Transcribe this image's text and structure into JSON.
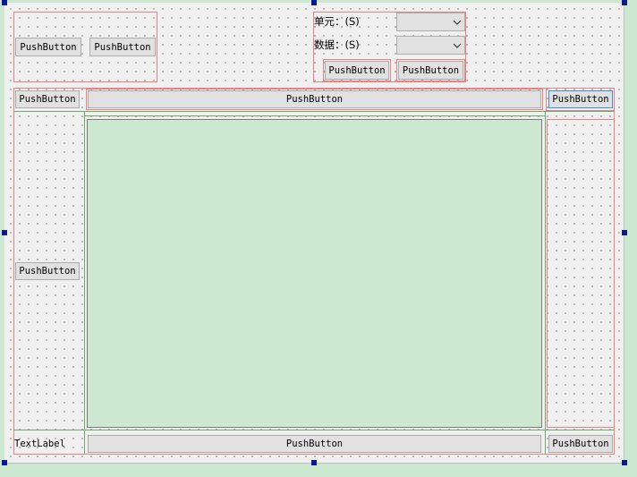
{
  "top_left_group": {
    "button_1": "PushButton",
    "button_2": "PushButton"
  },
  "top_right_group": {
    "unit_label": "单元：(S)",
    "data_label": "数据：(S)",
    "unit_combo_value": "",
    "data_combo_value": "",
    "button_1": "PushButton",
    "button_2": "PushButton"
  },
  "toolbar": {
    "left_button": "PushButton",
    "center_button": "PushButton",
    "right_button": "PushButton"
  },
  "side_panel": {
    "left_button": "PushButton"
  },
  "footer": {
    "text_label": "TextLabel",
    "center_button": "PushButton",
    "right_button": "PushButton"
  },
  "colors": {
    "canvas": "#f0f0f0",
    "layout_red": "#f08080",
    "layout_green": "#6aaa6a",
    "view_fill": "#cde8d0",
    "selection_handle": "#0a1a8c"
  }
}
